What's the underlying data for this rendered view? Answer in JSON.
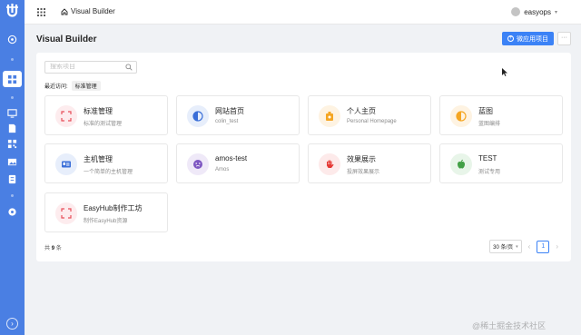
{
  "topbar": {
    "breadcrumb": "Visual Builder",
    "username": "easyops"
  },
  "header": {
    "title": "Visual Builder",
    "create_button": "微应用项目",
    "more_button": "···"
  },
  "search": {
    "placeholder": "搜索项目"
  },
  "recent": {
    "label": "最近访问:",
    "tag": "标准管理"
  },
  "projects": [
    {
      "name": "标准管理",
      "desc": "标准的测试管理",
      "icon": "frame-icon",
      "color": "#e8505b"
    },
    {
      "name": "网站首页",
      "desc": "colin_test",
      "icon": "half-circle-icon",
      "color": "#3b6fd8"
    },
    {
      "name": "个人主页",
      "desc": "Personal Homepage",
      "icon": "badge-icon",
      "color": "#f5a623"
    },
    {
      "name": "蓝图",
      "desc": "蓝图编排",
      "icon": "half-circle-icon",
      "color": "#f5a623"
    },
    {
      "name": "主机管理",
      "desc": "一个简单的主机管理",
      "icon": "id-card-icon",
      "color": "#3b6fd8"
    },
    {
      "name": "amos-test",
      "desc": "Amos",
      "icon": "face-icon",
      "color": "#7e57c2"
    },
    {
      "name": "效果展示",
      "desc": "投屏效果展示",
      "icon": "hand-icon",
      "color": "#e53935"
    },
    {
      "name": "TEST",
      "desc": "测试专用",
      "icon": "apple-icon",
      "color": "#43a047"
    },
    {
      "name": "EasyHub制作工坊",
      "desc": "制作EasyHub资源",
      "icon": "frame-icon",
      "color": "#e8505b"
    }
  ],
  "footer": {
    "total_prefix": "共",
    "total_count": "9",
    "total_suffix": "条",
    "page_size": "30 条/页",
    "current_page": "1"
  },
  "watermark": "@稀土掘金技术社区"
}
